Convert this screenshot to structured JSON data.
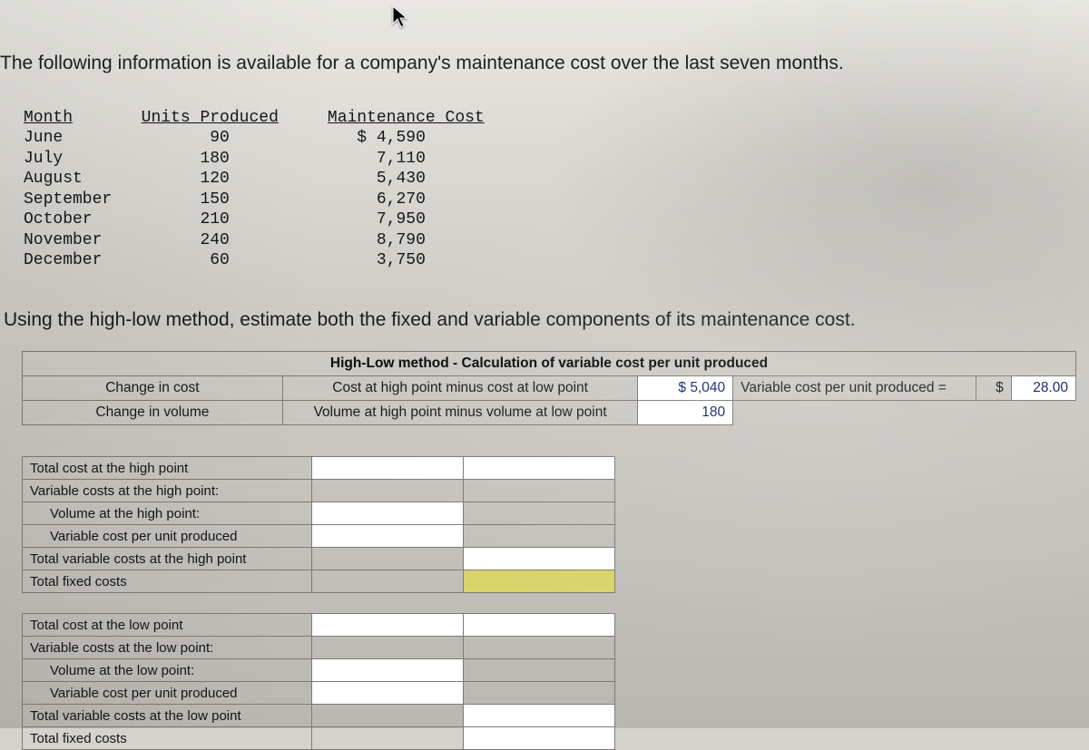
{
  "intro": "The following information is available for a company's maintenance cost over the last seven months.",
  "question": "Using the high-low method, estimate both the fixed and variable components of its maintenance cost.",
  "mono": {
    "h_month": "Month",
    "h_units": "Units Produced",
    "h_cost": "Maintenance Cost",
    "rows": [
      {
        "m": "June",
        "u": "90",
        "c": "$ 4,590"
      },
      {
        "m": "July",
        "u": "180",
        "c": "7,110"
      },
      {
        "m": "August",
        "u": "120",
        "c": "5,430"
      },
      {
        "m": "September",
        "u": "150",
        "c": "6,270"
      },
      {
        "m": "October",
        "u": "210",
        "c": "7,950"
      },
      {
        "m": "November",
        "u": "240",
        "c": "8,790"
      },
      {
        "m": "December",
        "u": "60",
        "c": "3,750"
      }
    ]
  },
  "hl": {
    "title": "High-Low method - Calculation of variable cost per unit produced",
    "row1_label": "Change in cost",
    "row1_desc": "Cost at high point minus cost at low point",
    "row1_val": "$  5,040",
    "row1_res_label": "Variable cost per unit produced =",
    "row1_sym": "$",
    "row1_res": "28.00",
    "row2_label": "Change in volume",
    "row2_desc": "Volume at high point minus volume at low point",
    "row2_val": "180"
  },
  "sec_high": {
    "r1": "Total cost at the high point",
    "r2": "Variable costs at the high point:",
    "r3": "Volume at the high point:",
    "r4": "Variable cost per unit produced",
    "r5": "Total variable costs at the high point",
    "r6": "Total fixed costs"
  },
  "sec_low": {
    "r1": "Total cost at the low point",
    "r2": "Variable costs at the low point:",
    "r3": "Volume at the low point:",
    "r4": "Variable cost per unit produced",
    "r5": "Total variable costs at the low point",
    "r6": "Total fixed costs"
  },
  "chart_data": {
    "type": "table",
    "columns": [
      "Month",
      "Units Produced",
      "Maintenance Cost"
    ],
    "rows": [
      [
        "June",
        90,
        4590
      ],
      [
        "July",
        180,
        7110
      ],
      [
        "August",
        120,
        5430
      ],
      [
        "September",
        150,
        6270
      ],
      [
        "October",
        210,
        7950
      ],
      [
        "November",
        240,
        8790
      ],
      [
        "December",
        60,
        3750
      ]
    ],
    "high_low": {
      "change_in_cost": 5040,
      "change_in_volume": 180,
      "variable_cost_per_unit": 28.0
    }
  }
}
